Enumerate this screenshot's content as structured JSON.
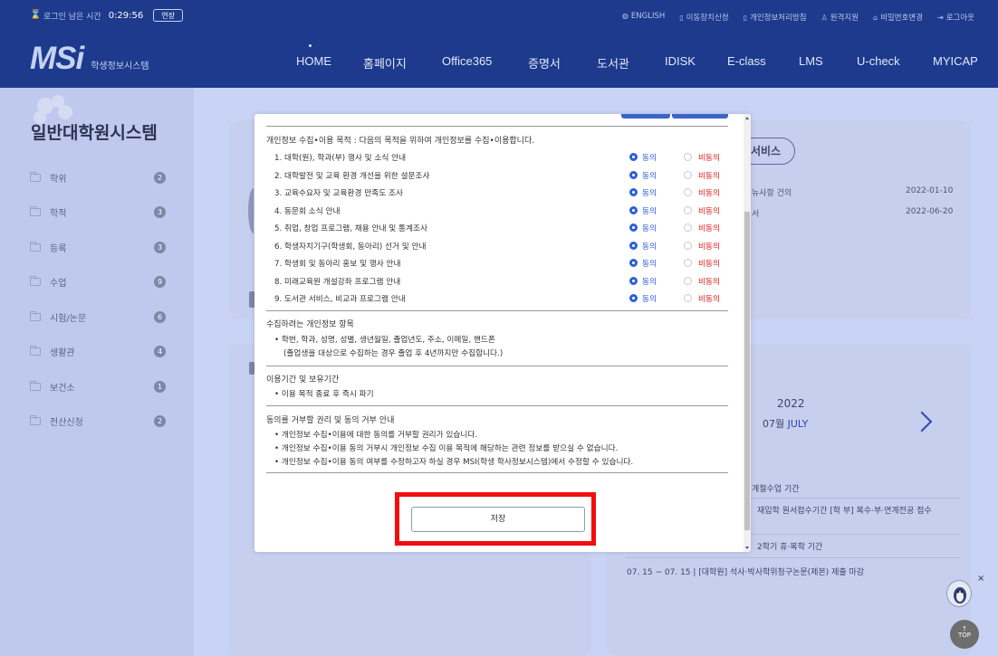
{
  "topbar": {
    "session_label": "로그인 남은 시간",
    "session_time": "0:29:56",
    "extend_label": "연장",
    "links": [
      {
        "icon": "globe-icon",
        "glyph": "◍",
        "label": "ENGLISH"
      },
      {
        "icon": "mobile-icon",
        "glyph": "▯",
        "label": "이동장치신청"
      },
      {
        "icon": "mobile-icon",
        "glyph": "▯",
        "label": "개인정보처리방침"
      },
      {
        "icon": "person-icon",
        "glyph": "♙",
        "label": "원격지원"
      },
      {
        "icon": "lock-icon",
        "glyph": "⌂",
        "label": "비밀번호변경"
      },
      {
        "icon": "logout-icon",
        "glyph": "⇥",
        "label": "로그아웃"
      }
    ]
  },
  "logo": {
    "mark": "MSi",
    "subtitle": "학생정보시스템"
  },
  "gnb": [
    "HOME",
    "홈페이지",
    "Office365",
    "증명서",
    "도서관",
    "IDISK",
    "E-class",
    "LMS",
    "U-check",
    "MYICAP"
  ],
  "sidebar": {
    "title": "일반대학원시스템",
    "items": [
      {
        "label": "학위",
        "count": "2"
      },
      {
        "label": "학적",
        "count": "3"
      },
      {
        "label": "등록",
        "count": "3"
      },
      {
        "label": "수업",
        "count": "9"
      },
      {
        "label": "시험/논문",
        "count": "6"
      },
      {
        "label": "생활관",
        "count": "4"
      },
      {
        "label": "보건소",
        "count": "1"
      },
      {
        "label": "전산신청",
        "count": "2"
      }
    ]
  },
  "background": {
    "service_label": "서비스",
    "notice_rows": [
      {
        "text": "뉴사항 건의",
        "date": "2022-01-10"
      },
      {
        "text": "서",
        "date": "2022-06-20"
      }
    ],
    "calendar": {
      "year": "2022",
      "month_num": "07월",
      "month_name": "JULY"
    },
    "events": [
      "계절수업 기간",
      "재입학 원서접수기간 [학 부] 복수·부·연계전공 접수",
      "2학기 휴·복학 기간",
      "07. 15 ~ 07. 15   |   [대학원] 석사·박사학위청구논문(제본) 제출 마감"
    ]
  },
  "modal": {
    "purpose_title": "개인정보 수집•이용 목적 : 다음의 목적을 위하여 개인정보를 수집•이용합니다.",
    "agree_label": "동의",
    "disagree_label": "비동의",
    "purposes": [
      "1. 대학(원), 학과(부) 행사 및 소식 안내",
      "2. 대학발전 및 교육 환경 개선을 위한 설문조사",
      "3. 교육수요자 및 교육환경 만족도 조사",
      "4. 동문회 소식 안내",
      "5. 취업, 창업 프로그램, 채용 안내 및 통계조사",
      "6. 학생자치기구(학생회, 동아리) 선거 및 안내",
      "7. 학생회 및 동아리 홍보 및 행사 안내",
      "8. 미래교육원 개설강좌 프로그램 안내",
      "9. 도서관 서비스, 비교과 프로그램 안내"
    ],
    "items_title": "수집하려는 개인정보 항목",
    "items_lines": [
      "•  학번, 학과, 성명, 성별, 생년월일, 졸업년도, 주소, 이메일, 핸드폰",
      "(졸업생을 대상으로 수집하는 경우 졸업 후 4년까지만 수집합니다.)"
    ],
    "period_title": "이용기간 및 보유기간",
    "period_lines": [
      "•  이용 목적 종료 후 즉시 파기"
    ],
    "refuse_title": "동의를 거부할 권리 및 동의 거부 안내",
    "refuse_lines": [
      "•  개인정보 수집•이용에 대한 동의를 거부할 권리가 있습니다.",
      "•  개인정보 수집•이용 동의 거부시 개인정보 수집 이용 목적에 해당하는 관련 정보를 받으실 수 없습니다.",
      "•  개인정보 수집•이용 동의 여부를 수정하고자 하실 경우 MSI(학생 학사정보시스템)에서 수정할 수 있습니다."
    ],
    "save_label": "저장"
  },
  "floating": {
    "top_label": "TOP",
    "close_glyph": "×"
  },
  "colors": {
    "brand": "#1d3a8c",
    "agree": "#2d5fd6",
    "disagree": "#e0201e",
    "highlight": "#f20e0e"
  }
}
